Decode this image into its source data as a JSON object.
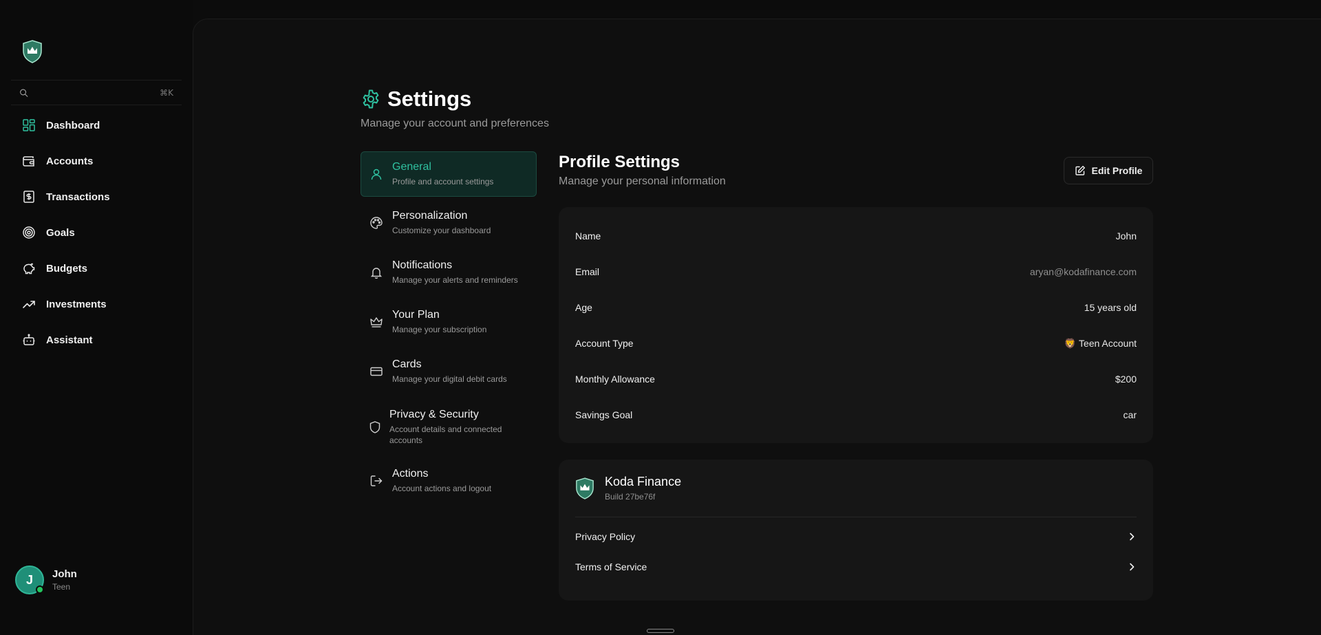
{
  "app": {
    "shortcut": "⌘K",
    "search_placeholder": ""
  },
  "sidebar": {
    "items": [
      {
        "label": "Dashboard",
        "icon": "dashboard-icon"
      },
      {
        "label": "Accounts",
        "icon": "wallet-icon"
      },
      {
        "label": "Transactions",
        "icon": "receipt-icon"
      },
      {
        "label": "Goals",
        "icon": "target-icon"
      },
      {
        "label": "Budgets",
        "icon": "piggy-bank-icon"
      },
      {
        "label": "Investments",
        "icon": "trending-up-icon"
      },
      {
        "label": "Assistant",
        "icon": "bot-icon"
      }
    ],
    "user": {
      "initial": "J",
      "name": "John",
      "role": "Teen"
    }
  },
  "page": {
    "title": "Settings",
    "subtitle": "Manage your account and preferences"
  },
  "settings_nav": [
    {
      "label": "General",
      "desc": "Profile and account settings",
      "icon": "user-icon",
      "active": true
    },
    {
      "label": "Personalization",
      "desc": "Customize your dashboard",
      "icon": "palette-icon"
    },
    {
      "label": "Notifications",
      "desc": "Manage your alerts and reminders",
      "icon": "bell-icon"
    },
    {
      "label": "Your Plan",
      "desc": "Manage your subscription",
      "icon": "crown-icon"
    },
    {
      "label": "Cards",
      "desc": "Manage your digital debit cards",
      "icon": "credit-card-icon"
    },
    {
      "label": "Privacy & Security",
      "desc": "Account details and connected accounts",
      "icon": "shield-icon"
    },
    {
      "label": "Actions",
      "desc": "Account actions and logout",
      "icon": "logout-icon"
    }
  ],
  "profile": {
    "title": "Profile Settings",
    "subtitle": "Manage your personal information",
    "edit_label": "Edit Profile",
    "rows": [
      {
        "label": "Name",
        "value": "John"
      },
      {
        "label": "Email",
        "value": "aryan@kodafinance.com"
      },
      {
        "label": "Age",
        "value": "15 years old"
      },
      {
        "label": "Account Type",
        "value": "🦁 Teen Account"
      },
      {
        "label": "Monthly Allowance",
        "value": "$200"
      },
      {
        "label": "Savings Goal",
        "value": "car"
      }
    ]
  },
  "about": {
    "name": "Koda Finance",
    "build": "Build 27be76f",
    "links": [
      "Privacy Policy",
      "Terms of Service"
    ]
  },
  "colors": {
    "accent": "#2fc1a0",
    "background": "#0c0c0c",
    "card": "#161616"
  }
}
